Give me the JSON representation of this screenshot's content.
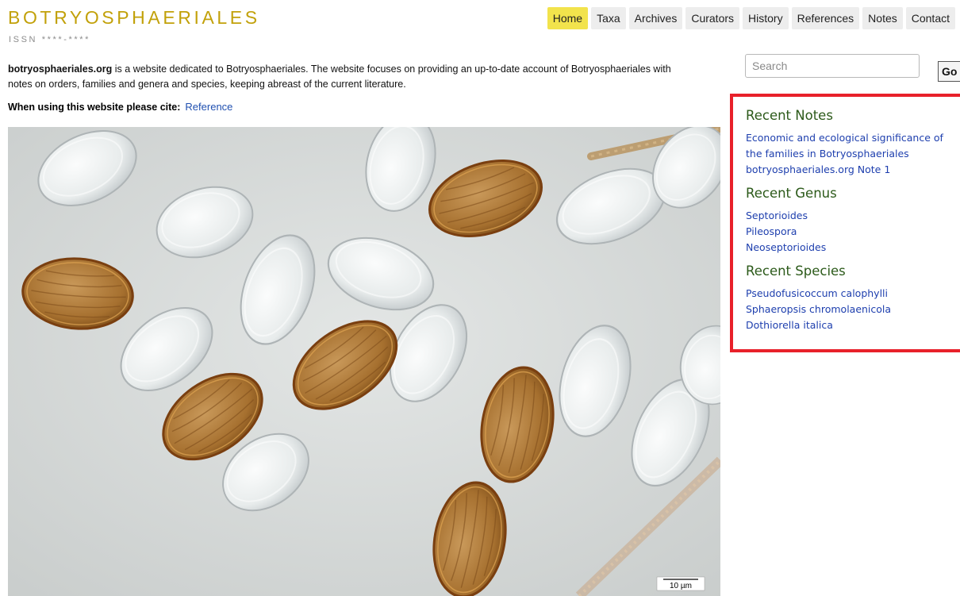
{
  "header": {
    "logo": "BOTRYOSPHAERIALES",
    "issn": "ISSN ****-****"
  },
  "nav": [
    {
      "label": "Home",
      "active": true
    },
    {
      "label": "Taxa"
    },
    {
      "label": "Archives"
    },
    {
      "label": "Curators"
    },
    {
      "label": "History"
    },
    {
      "label": "References"
    },
    {
      "label": "Notes"
    },
    {
      "label": "Contact"
    }
  ],
  "intro": {
    "site": "botryosphaeriales.org",
    "text": " is a website dedicated to Botryosphaeriales. The website focuses on providing an up-to-date account of Botryosphaeriales with notes on orders, families and genera and species, keeping abreast of the current literature."
  },
  "cite": {
    "label": "When using this website please cite:",
    "link": "Reference"
  },
  "image": {
    "scale_bar": "10 µm"
  },
  "search": {
    "placeholder": "Search",
    "button": "Go"
  },
  "sidebar": {
    "notes_heading": "Recent Notes",
    "notes": [
      "Economic and ecological significance of",
      "the families in Botryosphaeriales",
      "botryosphaeriales.org Note 1"
    ],
    "genus_heading": "Recent Genus",
    "genus": [
      "Septorioides",
      "Pileospora",
      "Neoseptorioides"
    ],
    "species_heading": "Recent Species",
    "species": [
      "Pseudofusicoccum calophylli",
      "Sphaeropsis chromolaenicola",
      "Dothiorella italica"
    ]
  },
  "colors": {
    "logo": "#c2a10a",
    "nav_active": "#f2e34c",
    "highlight_border": "#e8202a",
    "sidebar_heading": "#2c5a1a",
    "link": "#1e3fae"
  }
}
